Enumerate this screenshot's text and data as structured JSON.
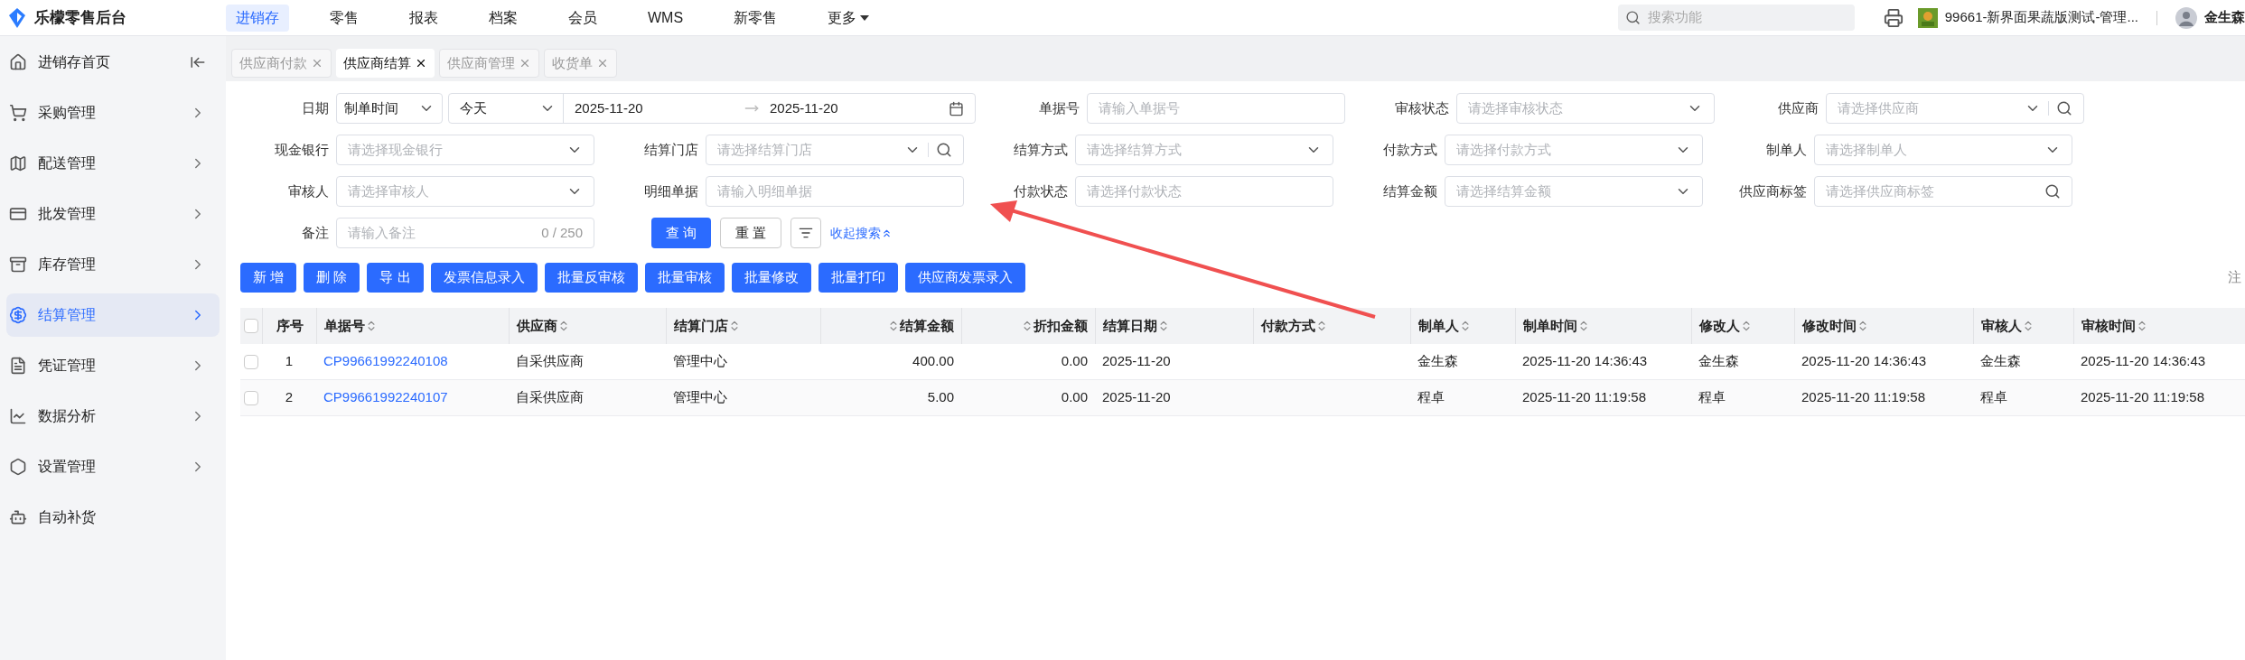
{
  "app": {
    "logo_text": "乐檬零售后台"
  },
  "nav": [
    {
      "label": "进销存",
      "selected": true
    },
    {
      "label": "零售",
      "selected": false
    },
    {
      "label": "报表",
      "selected": false
    },
    {
      "label": "档案",
      "selected": false
    },
    {
      "label": "会员",
      "selected": false
    },
    {
      "label": "WMS",
      "selected": false
    },
    {
      "label": "新零售",
      "selected": false
    },
    {
      "label": "更多",
      "selected": false,
      "dropdown": true
    }
  ],
  "header_right": {
    "search_placeholder": "搜索功能",
    "store": "99661-新界面果蔬版测试-管理...",
    "user": "金生森"
  },
  "sidebar": {
    "items": [
      {
        "label": "进销存首页",
        "selected": false,
        "kind": "home"
      },
      {
        "label": "采购管理",
        "selected": false,
        "kind": "group"
      },
      {
        "label": "配送管理",
        "selected": false,
        "kind": "group"
      },
      {
        "label": "批发管理",
        "selected": false,
        "kind": "group"
      },
      {
        "label": "库存管理",
        "selected": false,
        "kind": "group"
      },
      {
        "label": "结算管理",
        "selected": true,
        "kind": "group"
      },
      {
        "label": "凭证管理",
        "selected": false,
        "kind": "group"
      },
      {
        "label": "数据分析",
        "selected": false,
        "kind": "group"
      },
      {
        "label": "设置管理",
        "selected": false,
        "kind": "group"
      },
      {
        "label": "自动补货",
        "selected": false,
        "kind": "leaf"
      }
    ]
  },
  "tabs": [
    {
      "label": "供应商付款",
      "selected": false
    },
    {
      "label": "供应商结算",
      "selected": true
    },
    {
      "label": "供应商管理",
      "selected": false
    },
    {
      "label": "收货单",
      "selected": false
    }
  ],
  "filters": [
    [
      {
        "kind": "date",
        "label": "日期",
        "type_value": "制单时间",
        "range_value": "今天",
        "start": "2025-11-20",
        "end": "2025-11-20"
      },
      {
        "kind": "input",
        "label": "单据号",
        "placeholder": "请输入单据号"
      },
      {
        "kind": "select",
        "label": "审核状态",
        "placeholder": "请选择审核状态"
      },
      {
        "kind": "select_search",
        "label": "供应商",
        "placeholder": "请选择供应商"
      }
    ],
    [
      {
        "kind": "select",
        "label": "现金银行",
        "placeholder": "请选择现金银行"
      },
      {
        "kind": "select_search",
        "label": "结算门店",
        "placeholder": "请选择结算门店"
      },
      {
        "kind": "select",
        "label": "结算方式",
        "placeholder": "请选择结算方式"
      },
      {
        "kind": "select",
        "label": "付款方式",
        "placeholder": "请选择付款方式"
      },
      {
        "kind": "select",
        "label": "制单人",
        "placeholder": "请选择制单人"
      }
    ],
    [
      {
        "kind": "select",
        "label": "审核人",
        "placeholder": "请选择审核人"
      },
      {
        "kind": "input",
        "label": "明细单据",
        "placeholder": "请输入明细单据"
      },
      {
        "kind": "input",
        "label": "付款状态",
        "placeholder": "请选择付款状态"
      },
      {
        "kind": "select",
        "label": "结算金额",
        "placeholder": "请选择结算金额"
      },
      {
        "kind": "search",
        "label": "供应商标签",
        "placeholder": "请选择供应商标签"
      }
    ],
    [
      {
        "kind": "counter",
        "label": "备注",
        "placeholder": "请输入备注",
        "counter": "0 / 250"
      }
    ]
  ],
  "search_actions": {
    "query": "查 询",
    "reset": "重 置",
    "collapse": "收起搜索"
  },
  "actions": [
    "新 增",
    "删 除",
    "导 出",
    "发票信息录入",
    "批量反审核",
    "批量审核",
    "批量修改",
    "批量打印",
    "供应商发票录入"
  ],
  "side_note": "注",
  "table": {
    "header_checked": false,
    "columns": [
      {
        "label": "序号",
        "sortable": false,
        "kind": "index"
      },
      {
        "label": "单据号",
        "sortable": true,
        "kind": "text"
      },
      {
        "label": "供应商",
        "sortable": true,
        "kind": "text"
      },
      {
        "label": "结算门店",
        "sortable": true,
        "kind": "text"
      },
      {
        "label": "结算金额",
        "sortable": true,
        "kind": "number"
      },
      {
        "label": "折扣金额",
        "sortable": true,
        "kind": "number"
      },
      {
        "label": "结算日期",
        "sortable": true,
        "kind": "text"
      },
      {
        "label": "付款方式",
        "sortable": true,
        "kind": "text"
      },
      {
        "label": "制单人",
        "sortable": true,
        "kind": "text"
      },
      {
        "label": "制单时间",
        "sortable": true,
        "kind": "text"
      },
      {
        "label": "修改人",
        "sortable": true,
        "kind": "text"
      },
      {
        "label": "修改时间",
        "sortable": true,
        "kind": "text"
      },
      {
        "label": "审核人",
        "sortable": true,
        "kind": "text"
      },
      {
        "label": "审核时间",
        "sortable": true,
        "kind": "text"
      }
    ],
    "rows": [
      {
        "checked": false,
        "cells": [
          "1",
          "CP99661992240108",
          "自采供应商",
          "管理中心",
          "400.00",
          "0.00",
          "2025-11-20",
          "",
          "金生森",
          "2025-11-20 14:36:43",
          "金生森",
          "2025-11-20 14:36:43",
          "金生森",
          "2025-11-20 14:36:43"
        ]
      },
      {
        "checked": false,
        "cells": [
          "2",
          "CP99661992240107",
          "自采供应商",
          "管理中心",
          "5.00",
          "0.00",
          "2025-11-20",
          "",
          "程卓",
          "2025-11-20 11:19:58",
          "程卓",
          "2025-11-20 11:19:58",
          "程卓",
          "2025-11-20 11:19:58"
        ]
      }
    ]
  }
}
